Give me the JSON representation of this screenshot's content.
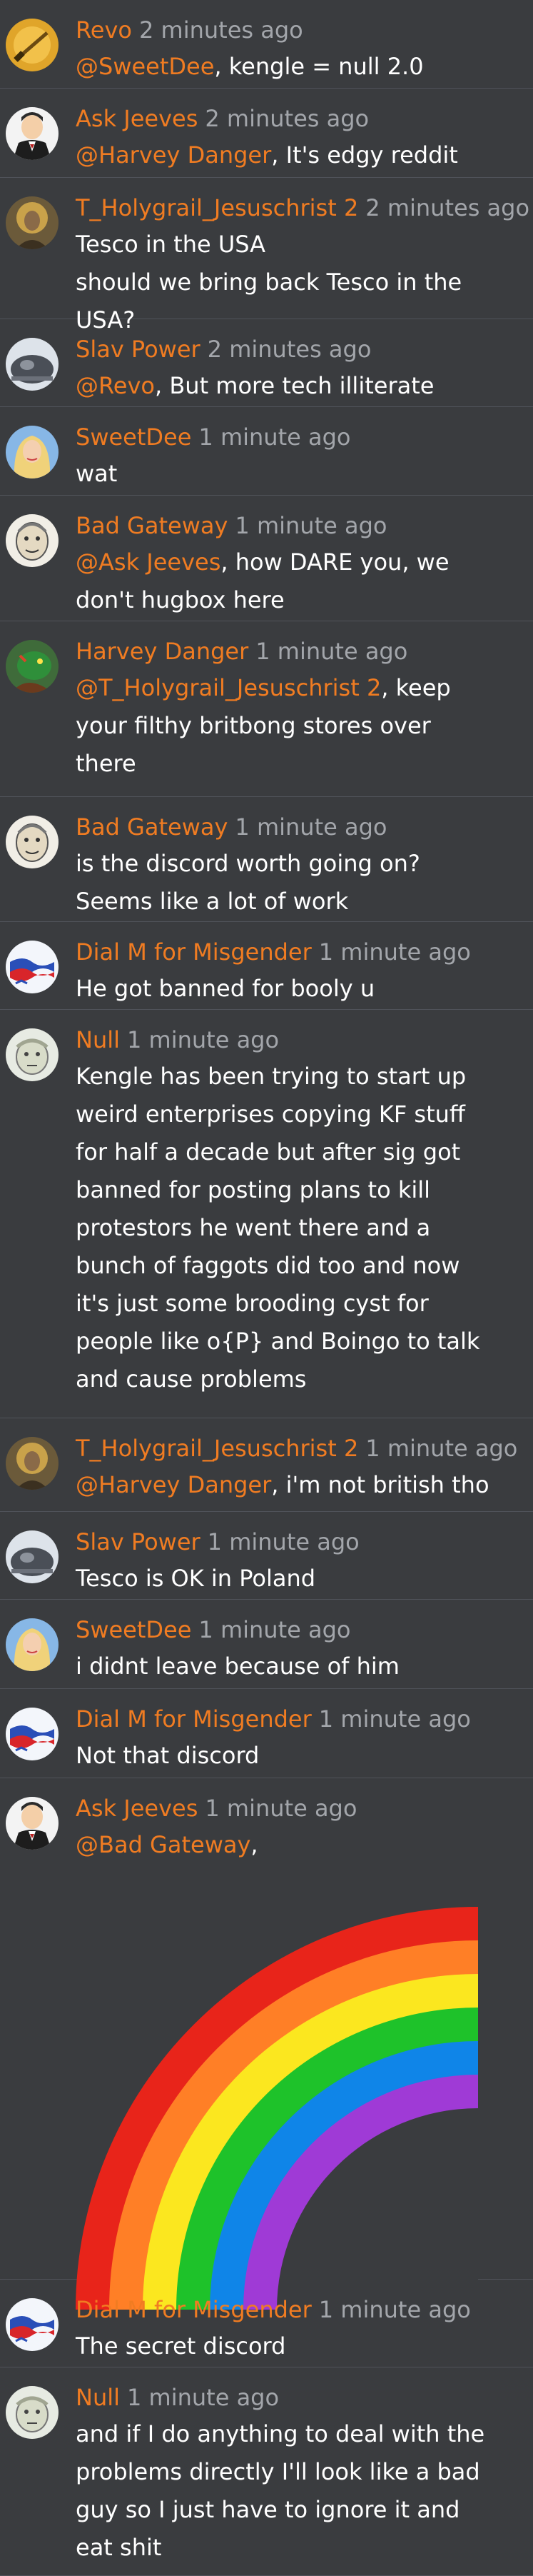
{
  "colors": {
    "background": "#3a3c3f",
    "divider": "#50535a",
    "author": "#f07c22",
    "mention": "#f07c22",
    "timestamp": "#a3a6ab",
    "text": "#ffffff"
  },
  "messages": [
    {
      "author": "Revo",
      "time": "2 minutes ago",
      "avatar": "gold-sword-avatar",
      "mention": "@SweetDee",
      "text": ", kengle = null 2.0"
    },
    {
      "author": "Ask Jeeves",
      "time": "2 minutes ago",
      "avatar": "butler-avatar",
      "mention": "@Harvey Danger",
      "text": ", It's edgy reddit"
    },
    {
      "author": "T_Holygrail_Jesuschrist 2",
      "time": "2 minutes ago",
      "avatar": "christ-icon-avatar",
      "mention": "",
      "text": "Tesco in the USA\nshould we bring back Tesco in the\nUSA?"
    },
    {
      "author": "Slav Power",
      "time": "2 minutes ago",
      "avatar": "blob-avatar",
      "mention": "@Revo",
      "text": ", But more tech illiterate"
    },
    {
      "author": "SweetDee",
      "time": "1 minute ago",
      "avatar": "blonde-woman-avatar",
      "mention": "",
      "text": "wat"
    },
    {
      "author": "Bad Gateway",
      "time": "1 minute ago",
      "avatar": "gateway-face-avatar",
      "mention": "@Ask Jeeves",
      "text": ", how DARE you, we\ndon't hugbox here"
    },
    {
      "author": "Harvey Danger",
      "time": "1 minute ago",
      "avatar": "green-creature-avatar",
      "mention": "@T_Holygrail_Jesuschrist 2",
      "text": ", keep\nyour filthy britbong stores over\nthere"
    },
    {
      "author": "Bad Gateway",
      "time": "1 minute ago",
      "avatar": "gateway-face-avatar",
      "mention": "",
      "text": "is the discord worth going on?\nSeems like a lot of work"
    },
    {
      "author": "Dial M for Misgender",
      "time": "1 minute ago",
      "avatar": "flag-avatar",
      "mention": "",
      "text": "He got banned for booly u"
    },
    {
      "author": "Null",
      "time": "1 minute ago",
      "avatar": "null-face-avatar",
      "mention": "",
      "text": "Kengle has been trying to start up\nweird enterprises copying KF stuff\nfor half a decade but after sig got\nbanned for posting plans to kill\nprotestors he went there and a\nbunch of faggots did too and now\nit's just some brooding cyst for\npeople like o{P} and Boingo to talk\nand cause problems"
    },
    {
      "author": "T_Holygrail_Jesuschrist 2",
      "time": "1 minute ago",
      "avatar": "christ-icon-avatar",
      "mention": "@Harvey Danger",
      "text": ", i'm not british tho"
    },
    {
      "author": "Slav Power",
      "time": "1 minute ago",
      "avatar": "blob-avatar",
      "mention": "",
      "text": "Tesco is OK in Poland"
    },
    {
      "author": "SweetDee",
      "time": "1 minute ago",
      "avatar": "blonde-woman-avatar",
      "mention": "",
      "text": "i didnt leave because of him"
    },
    {
      "author": "Dial M for Misgender",
      "time": "1 minute ago",
      "avatar": "flag-avatar",
      "mention": "",
      "text": "Not that discord"
    },
    {
      "author": "Ask Jeeves",
      "time": "1 minute ago",
      "avatar": "butler-avatar",
      "mention": "@Bad Gateway",
      "text": ",",
      "image": "rainbow-image"
    },
    {
      "author": "Dial M for Misgender",
      "time": "1 minute ago",
      "avatar": "flag-avatar",
      "mention": "",
      "text": "The secret discord"
    },
    {
      "author": "Null",
      "time": "1 minute ago",
      "avatar": "null-face-avatar",
      "mention": "",
      "text": "and if I do anything to deal with the\nproblems directly I'll look like a bad\nguy so I just have to ignore it and\neat shit"
    }
  ],
  "rainbow_colors": [
    "#e8241a",
    "#ff7f26",
    "#fbe71f",
    "#1ec22a",
    "#0f85e8",
    "#9f3ad6"
  ]
}
